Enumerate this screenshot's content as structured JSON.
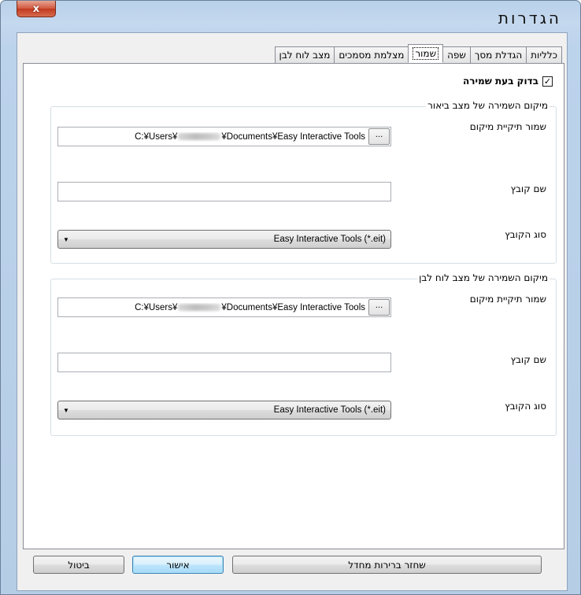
{
  "window": {
    "title": "הגדרות",
    "close_glyph": "x"
  },
  "tabs": [
    {
      "label": "כלליות"
    },
    {
      "label": "הגדלת מסך"
    },
    {
      "label": "שפה"
    },
    {
      "label": "שמור",
      "active": true
    },
    {
      "label": "מצלמת מסמכים"
    },
    {
      "label": "מצב לוח לבן"
    }
  ],
  "save_tab": {
    "check_on_save": {
      "label": "בדוק בעת שמירה",
      "checked": true,
      "mark": "✓"
    },
    "annotation_group": {
      "title": "מיקום השמירה של מצב ביאור",
      "folder_label": "שמור תיקיית מיקום",
      "path_prefix": "C:¥Users¥",
      "path_suffix": "¥Documents¥Easy Interactive Tools",
      "browse_label": "...",
      "filename_label": "שם קובץ",
      "filename_value": "",
      "filetype_label": "סוג הקובץ",
      "filetype_value": "Easy Interactive Tools (*.eit)"
    },
    "whiteboard_group": {
      "title": "מיקום השמירה של מצב לוח לבן",
      "folder_label": "שמור תיקיית מיקום",
      "path_prefix": "C:¥Users¥",
      "path_suffix": "¥Documents¥Easy Interactive Tools",
      "browse_label": "...",
      "filename_label": "שם קובץ",
      "filename_value": "",
      "filetype_label": "סוג הקובץ",
      "filetype_value": "Easy Interactive Tools (*.eit)"
    }
  },
  "buttons": {
    "restore_defaults": "שחזר ברירות מחדל",
    "ok": "אישור",
    "cancel": "ביטול"
  },
  "colors": {
    "frame": "#b9d1ea",
    "close": "#c1391f",
    "default_button_border": "#3c7fb1"
  }
}
